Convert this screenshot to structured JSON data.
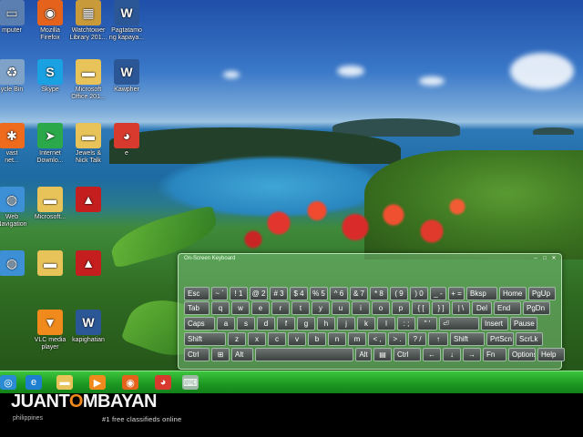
{
  "desktop": {
    "icons": [
      {
        "label": "mputer",
        "icon": "computer-icon",
        "color": "#5a7fb0"
      },
      {
        "label": "Mozilla\nFirefox",
        "icon": "firefox-icon",
        "color": "#e4621c"
      },
      {
        "label": "Watchtower\nLibrary 201...",
        "icon": "watchtower-library-icon",
        "color": "#c99a3a"
      },
      {
        "label": "Pagtatamo\nng kapaya...",
        "icon": "word-document-icon",
        "color": "#2b5797"
      },
      {
        "label": "ycle Bin",
        "icon": "recycle-bin-icon",
        "color": "#7fa2c8"
      },
      {
        "label": "Skype",
        "icon": "skype-icon",
        "color": "#1aa1e1"
      },
      {
        "label": "Microsoft\nOffice 201...",
        "icon": "folder-icon",
        "color": "#e8c35a"
      },
      {
        "label": "Kawpher",
        "icon": "word-document-icon",
        "color": "#2b5797"
      },
      {
        "label": "vast\nnet...",
        "icon": "avast-icon",
        "color": "#ee6a1d"
      },
      {
        "label": "Internet\nDownlo...",
        "icon": "internet-download-manager-icon",
        "color": "#2aa84a"
      },
      {
        "label": "Jewels &\nNick Talk",
        "icon": "folder-icon",
        "color": "#e8c35a"
      },
      {
        "label": "e",
        "icon": "chrome-icon",
        "color": "#d83b2e"
      },
      {
        "label": "Web\nNavigation",
        "icon": "globe-icon",
        "color": "#3d8fd6"
      },
      {
        "label": "Microsoft...",
        "icon": "folder-icon",
        "color": "#e8c35a"
      },
      {
        "label": "",
        "icon": "adobe-reader-icon",
        "color": "#c41e1e"
      },
      {
        "label": "",
        "icon": "globe-icon",
        "color": "#3d8fd6"
      },
      {
        "label": "",
        "icon": "folder-icon",
        "color": "#e8c35a"
      },
      {
        "label": "",
        "icon": "adobe-reader-icon",
        "color": "#c41e1e"
      },
      {
        "label": "VLC media\nplayer",
        "icon": "vlc-icon",
        "color": "#f08a1c"
      },
      {
        "label": "kapighatian",
        "icon": "word-document-icon",
        "color": "#2b5797"
      }
    ]
  },
  "osk": {
    "title": "On-Screen Keyboard",
    "window_controls": [
      "–",
      "□",
      "✕"
    ],
    "rows": [
      [
        "Esc",
        "~ `",
        "! 1",
        "@ 2",
        "# 3",
        "$ 4",
        "% 5",
        "^ 6",
        "& 7",
        "* 8",
        "( 9",
        ") 0",
        "_ -",
        "+ =",
        "Bksp",
        "Home",
        "PgUp"
      ],
      [
        "Tab",
        "q",
        "w",
        "e",
        "r",
        "t",
        "y",
        "u",
        "i",
        "o",
        "p",
        "{ [",
        "} ]",
        "| \\",
        "Del",
        "End",
        "PgDn"
      ],
      [
        "Caps",
        "a",
        "s",
        "d",
        "f",
        "g",
        "h",
        "j",
        "k",
        "l",
        ": ;",
        "\" '",
        "⏎",
        "Insert",
        "Pause"
      ],
      [
        "Shift",
        "z",
        "x",
        "c",
        "v",
        "b",
        "n",
        "m",
        "< ,",
        "> .",
        "? /",
        "↑",
        "Shift",
        "PrtScn",
        "ScrLk"
      ],
      [
        "Ctrl",
        "⊞",
        "Alt",
        "",
        "Alt",
        "▤",
        "Ctrl",
        "←",
        "↓",
        "→",
        "Fn",
        "Options",
        "Help"
      ]
    ]
  },
  "taskbar": {
    "items": [
      {
        "icon": "start-orb-icon",
        "color": "#2a8ad4"
      },
      {
        "icon": "internet-explorer-icon",
        "color": "#1e7fd1"
      },
      {
        "icon": "file-explorer-icon",
        "color": "#e8c35a"
      },
      {
        "icon": "media-player-icon",
        "color": "#f08a1c"
      },
      {
        "icon": "firefox-icon",
        "color": "#e4621c"
      },
      {
        "icon": "chrome-icon",
        "color": "#d83b2e"
      },
      {
        "icon": "on-screen-keyboard-taskbar-icon",
        "color": "#9fb9a6"
      }
    ]
  },
  "watermark": {
    "brand_left": "JUANT",
    "brand_mid": "O",
    "brand_right": "MBAYAN",
    "country": "philippines",
    "tagline": "#1 free classifieds online"
  }
}
